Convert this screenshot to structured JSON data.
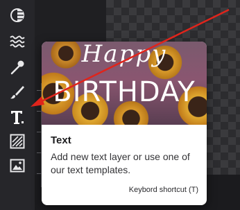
{
  "sidebar": {
    "tools": [
      {
        "name": "Filters",
        "icon": "filters-icon"
      },
      {
        "name": "Effects",
        "icon": "effects-icon"
      },
      {
        "name": "Retouch",
        "icon": "retouch-icon"
      },
      {
        "name": "Paint",
        "icon": "paint-brush-icon"
      },
      {
        "name": "Text",
        "icon": "text-icon"
      },
      {
        "name": "Overlays",
        "icon": "overlay-icon"
      },
      {
        "name": "Image",
        "icon": "image-icon"
      }
    ]
  },
  "tooltip": {
    "preview_script": "Happy",
    "preview_big": "BIRTHDAY",
    "title": "Text",
    "description": "Add new text layer or use one of our text templates.",
    "shortcut": "Keybord shortcut (T)"
  },
  "colors": {
    "sidebar_bg": "#26262a",
    "icon_color": "#e8e8ea",
    "arrow_red": "#e0241b",
    "card_bg": "#ffffff"
  }
}
